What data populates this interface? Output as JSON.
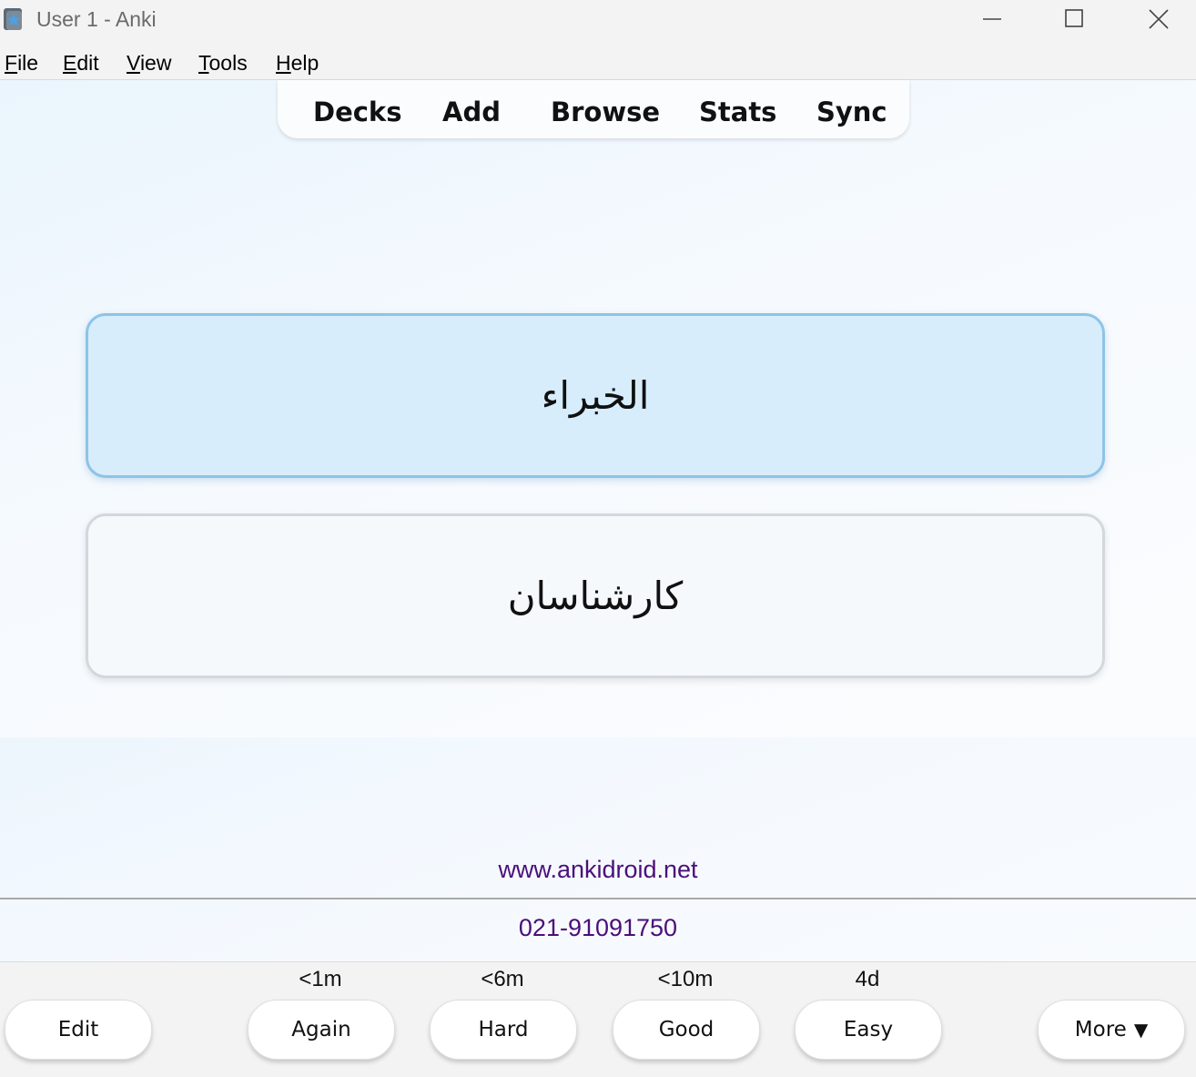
{
  "window": {
    "title": "User 1 - Anki",
    "icon": "anki-star-icon"
  },
  "menu": [
    {
      "mnemonic": "F",
      "rest": "ile"
    },
    {
      "mnemonic": "E",
      "rest": "dit"
    },
    {
      "mnemonic": "V",
      "rest": "iew"
    },
    {
      "mnemonic": "T",
      "rest": "ools"
    },
    {
      "mnemonic": "H",
      "rest": "elp"
    }
  ],
  "toolbar": {
    "decks": "Decks",
    "add": "Add",
    "browse": "Browse",
    "stats": "Stats",
    "sync": "Sync"
  },
  "card": {
    "front": "الخبراء",
    "back": "كارشناسان"
  },
  "footer": {
    "website": "www.ankidroid.net",
    "phone": "021-91091750",
    "link_color": "#4b0f7a"
  },
  "answer_bar": {
    "edit": "Edit",
    "again": {
      "label": "Again",
      "interval": "<1m"
    },
    "hard": {
      "label": "Hard",
      "interval": "<6m"
    },
    "good": {
      "label": "Good",
      "interval": "<10m"
    },
    "easy": {
      "label": "Easy",
      "interval": "4d"
    },
    "more": "More",
    "more_arrow": "▼"
  },
  "colors": {
    "card_front_bg": "#d7edfc",
    "card_front_border": "#8ec4e6",
    "card_back_bg": "#f6f9fc"
  }
}
